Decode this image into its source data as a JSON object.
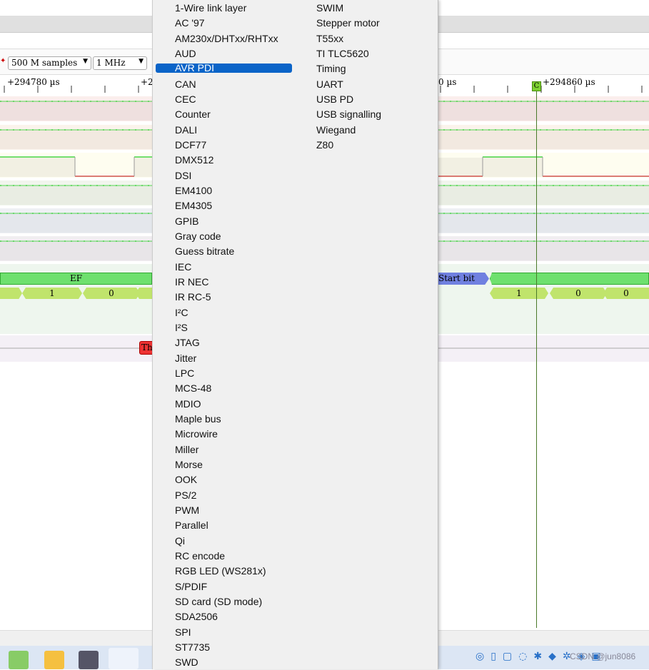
{
  "toolbar": {
    "samples": "500 M samples",
    "rate": "1 MHz"
  },
  "ruler": {
    "labels": [
      "+294780 µs",
      "+2",
      "0 µs",
      "+294860 µs"
    ]
  },
  "cursor": {
    "label": "C"
  },
  "decoder": {
    "bytes": [
      "EF",
      "Start bit"
    ],
    "bits": [
      "1",
      "0",
      "1",
      "0",
      "0"
    ],
    "annotation": "Th"
  },
  "menu": {
    "col1": [
      "1-Wire link layer",
      "AC '97",
      "AM230x/DHTxx/RHTxx",
      "AUD",
      "AVR PDI",
      "CAN",
      "CEC",
      "Counter",
      "DALI",
      "DCF77",
      "DMX512",
      "DSI",
      "EM4100",
      "EM4305",
      "GPIB",
      "Gray code",
      "Guess bitrate",
      "IEC",
      "IR NEC",
      "IR RC-5",
      "I²C",
      "I²S",
      "JTAG",
      "Jitter",
      "LPC",
      "MCS-48",
      "MDIO",
      "Maple bus",
      "Microwire",
      "Miller",
      "Morse",
      "OOK",
      "PS/2",
      "PWM",
      "Parallel",
      "Qi",
      "RC encode",
      "RGB LED (WS281x)",
      "S/PDIF",
      "SD card (SD mode)",
      "SDA2506",
      "SPI",
      "ST7735",
      "SWD"
    ],
    "col2": [
      "SWIM",
      "Stepper motor",
      "T55xx",
      "TI TLC5620",
      "Timing",
      "UART",
      "USB PD",
      "USB signalling",
      "Wiegand",
      "Z80"
    ],
    "selected": "AVR PDI"
  },
  "taskbar": {
    "watermark": "CSDN @jun8086"
  },
  "colors": {
    "accent": "#0a64c8",
    "trace_high": "#22cc22",
    "trace_low": "#cc3333",
    "decoder_bar": "#6ee06e",
    "bit_bar": "#c0e46c",
    "start_bit": "#7080e0"
  }
}
